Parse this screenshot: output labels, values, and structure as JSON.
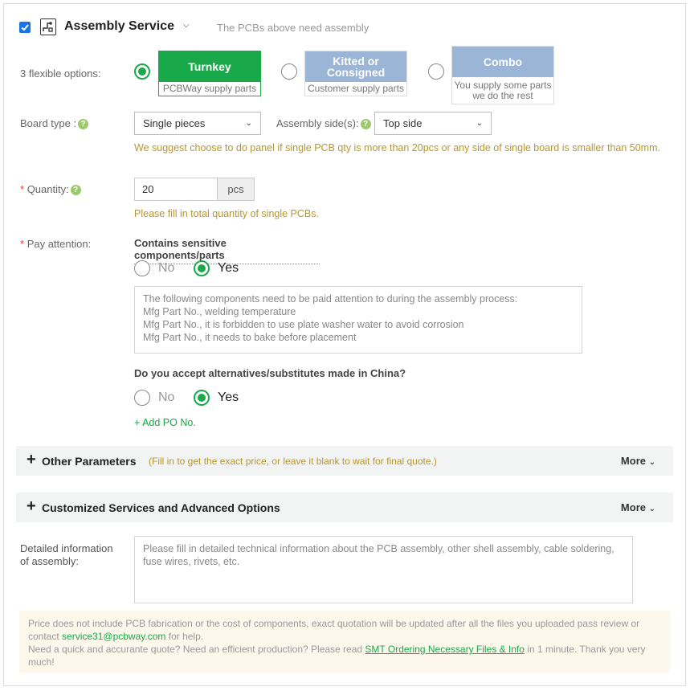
{
  "header": {
    "title": "Assembly Service",
    "subtitle": "The PCBs above need assembly",
    "checked": true
  },
  "options": {
    "label": "3 flexible options:",
    "items": [
      {
        "title": "Turnkey",
        "sub": "PCBWay supply parts",
        "selected": true,
        "color": "#19a84a"
      },
      {
        "title": "Kitted or Consigned",
        "sub": "Customer supply parts",
        "selected": false,
        "color": "#9ab5d6"
      },
      {
        "title": "Combo",
        "sub": "You supply some parts we do the rest",
        "selected": false,
        "color": "#9ab5d6"
      }
    ]
  },
  "board_type": {
    "label": "Board type :",
    "value": "Single pieces",
    "side_label": "Assembly side(s):",
    "side_value": "Top side",
    "hint": "We suggest choose to do panel if single PCB qty is more than 20pcs or any side of single board is smaller than 50mm."
  },
  "quantity": {
    "required_mark": "*",
    "label": "Quantity:",
    "value": "20",
    "unit": "pcs",
    "hint": "Please fill in total quantity of single PCBs."
  },
  "attention": {
    "required_mark": "*",
    "label": "Pay attention:",
    "question": "Contains sensitive components/parts",
    "no_label": "No",
    "yes_label": "Yes",
    "placeholder_lines": [
      "The following components need to be paid attention to during the assembly process:",
      "Mfg Part No., welding temperature",
      "Mfg Part No., it is forbidden to use plate washer water to avoid corrosion",
      "Mfg Part No., it needs to bake before placement"
    ],
    "alt_question": "Do you accept alternatives/substitutes made in China?",
    "alt_no_label": "No",
    "alt_yes_label": "Yes",
    "add_po": "+ Add PO No."
  },
  "other_params": {
    "title": "Other Parameters",
    "note": "(Fill in to get the exact price, or leave it blank to wait for final quote.)",
    "more": "More"
  },
  "custom_services": {
    "title": "Customized Services and Advanced Options",
    "more": "More"
  },
  "detail": {
    "label": "Detailed information of assembly:",
    "placeholder": "Please fill in detailed technical information about the PCB assembly, other shell assembly, cable soldering, fuse wires, rivets, etc."
  },
  "notice": {
    "line1": "Price does not include PCB fabrication or the cost of components, exact quotation will be updated after all the files you uploaded pass review or contact",
    "email": "service31@pcbway.com",
    "line1_end": "for help.",
    "line2": "Need a quick and accurante quote? Need an efficient production? Please read",
    "link": "SMT Ordering Necessary Files & Info",
    "line2_end": "in 1 minute. Thank you very much!"
  }
}
